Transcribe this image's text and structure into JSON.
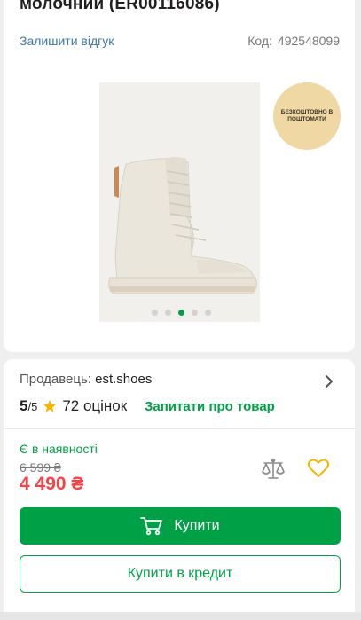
{
  "product": {
    "title": "молочний (ER00116086)",
    "review_link": "Залишити відгук",
    "code_label": "Код:",
    "code_value": "492548099"
  },
  "gallery": {
    "badge_text": "БЕЗКОШТОВНО В ПОШТОМАТИ",
    "slides_total": 5,
    "active_slide": 3
  },
  "seller": {
    "label": "Продавець:",
    "name": "est.shoes"
  },
  "rating": {
    "score": "5",
    "max": "/5",
    "reviews": "72 оцінок",
    "ask_link": "Запитати про товар"
  },
  "pricing": {
    "availability": "Є в наявності",
    "old_price": "6 599 ₴",
    "price": "4 490 ₴"
  },
  "actions": {
    "buy_label": "Купити",
    "credit_label": "Купити в кредит"
  },
  "icons": {
    "seller": "chevron-right-icon",
    "rating": "star-icon",
    "compare": "scales-icon",
    "wishlist": "heart-icon",
    "buy": "cart-icon"
  },
  "colors": {
    "accent_green": "#00a046",
    "price_red": "#f84147",
    "link_blue": "#3e77aa",
    "star": "#f2b600",
    "wishlist": "#f2b600"
  }
}
